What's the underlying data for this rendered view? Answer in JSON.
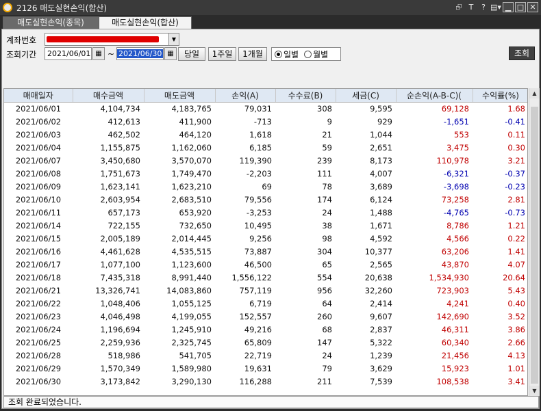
{
  "window": {
    "title": "2126 매도실현손익(합산)",
    "controls": [
      "⮺",
      "T",
      "?",
      "▤▾",
      "▁",
      "□",
      "✕"
    ]
  },
  "tabs": [
    {
      "label": "매도실현손익(종목)"
    },
    {
      "label": "매도실현손익(합산)"
    }
  ],
  "form": {
    "account_label": "계좌번호",
    "period_label": "조회기간",
    "date_from": "2021/06/01",
    "tilde": "~",
    "date_to": "2021/06/30",
    "btn_today": "당일",
    "btn_week": "1주일",
    "btn_month": "1개월",
    "radio_daily": "일별",
    "radio_monthly": "월별",
    "query_button": "조회"
  },
  "table": {
    "columns": [
      "매매일자",
      "매수금액",
      "매도금액",
      "손익(A)",
      "수수료(B)",
      "세금(C)",
      "순손익(A-B-C)(",
      "수익률(%)"
    ],
    "rows": [
      [
        "2021/06/01",
        "4,104,734",
        "4,183,765",
        "79,031",
        "308",
        "9,595",
        "69,128",
        "1.68"
      ],
      [
        "2021/06/02",
        "412,613",
        "411,900",
        "-713",
        "9",
        "929",
        "-1,651",
        "-0.41"
      ],
      [
        "2021/06/03",
        "462,502",
        "464,120",
        "1,618",
        "21",
        "1,044",
        "553",
        "0.11"
      ],
      [
        "2021/06/04",
        "1,155,875",
        "1,162,060",
        "6,185",
        "59",
        "2,651",
        "3,475",
        "0.30"
      ],
      [
        "2021/06/07",
        "3,450,680",
        "3,570,070",
        "119,390",
        "239",
        "8,173",
        "110,978",
        "3.21"
      ],
      [
        "2021/06/08",
        "1,751,673",
        "1,749,470",
        "-2,203",
        "111",
        "4,007",
        "-6,321",
        "-0.37"
      ],
      [
        "2021/06/09",
        "1,623,141",
        "1,623,210",
        "69",
        "78",
        "3,689",
        "-3,698",
        "-0.23"
      ],
      [
        "2021/06/10",
        "2,603,954",
        "2,683,510",
        "79,556",
        "174",
        "6,124",
        "73,258",
        "2.81"
      ],
      [
        "2021/06/11",
        "657,173",
        "653,920",
        "-3,253",
        "24",
        "1,488",
        "-4,765",
        "-0.73"
      ],
      [
        "2021/06/14",
        "722,155",
        "732,650",
        "10,495",
        "38",
        "1,671",
        "8,786",
        "1.21"
      ],
      [
        "2021/06/15",
        "2,005,189",
        "2,014,445",
        "9,256",
        "98",
        "4,592",
        "4,566",
        "0.22"
      ],
      [
        "2021/06/16",
        "4,461,628",
        "4,535,515",
        "73,887",
        "304",
        "10,377",
        "63,206",
        "1.41"
      ],
      [
        "2021/06/17",
        "1,077,100",
        "1,123,600",
        "46,500",
        "65",
        "2,565",
        "43,870",
        "4.07"
      ],
      [
        "2021/06/18",
        "7,435,318",
        "8,991,440",
        "1,556,122",
        "554",
        "20,638",
        "1,534,930",
        "20.64"
      ],
      [
        "2021/06/21",
        "13,326,741",
        "14,083,860",
        "757,119",
        "956",
        "32,260",
        "723,903",
        "5.43"
      ],
      [
        "2021/06/22",
        "1,048,406",
        "1,055,125",
        "6,719",
        "64",
        "2,414",
        "4,241",
        "0.40"
      ],
      [
        "2021/06/23",
        "4,046,498",
        "4,199,055",
        "152,557",
        "260",
        "9,607",
        "142,690",
        "3.52"
      ],
      [
        "2021/06/24",
        "1,196,694",
        "1,245,910",
        "49,216",
        "68",
        "2,837",
        "46,311",
        "3.86"
      ],
      [
        "2021/06/25",
        "2,259,936",
        "2,325,745",
        "65,809",
        "147",
        "5,322",
        "60,340",
        "2.66"
      ],
      [
        "2021/06/28",
        "518,986",
        "541,705",
        "22,719",
        "24",
        "1,239",
        "21,456",
        "4.13"
      ],
      [
        "2021/06/29",
        "1,570,349",
        "1,589,980",
        "19,631",
        "79",
        "3,629",
        "15,923",
        "1.01"
      ],
      [
        "2021/06/30",
        "3,173,842",
        "3,290,130",
        "116,288",
        "211",
        "7,539",
        "108,538",
        "3.41"
      ]
    ]
  },
  "colors": {
    "profit": "#c00000",
    "loss": "#0000b0",
    "header_bg": "#dfe8f3",
    "selection": "#2257c9"
  },
  "status": "조회 완료되었습니다."
}
